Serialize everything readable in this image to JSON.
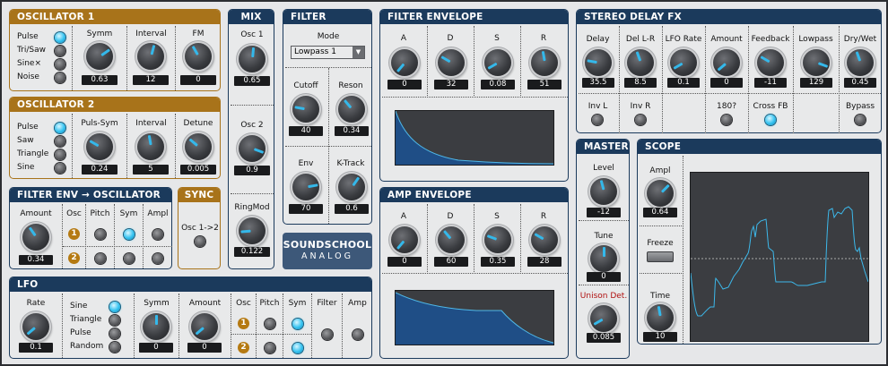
{
  "osc1": {
    "title": "OSCILLATOR 1",
    "waves": [
      "Pulse",
      "Tri/Saw",
      "Sine×",
      "Noise"
    ],
    "symm_label": "Symm",
    "interval_label": "Interval",
    "fm_label": "FM",
    "symm": "0.63",
    "interval": "12",
    "fm": "0"
  },
  "osc2": {
    "title": "OSCILLATOR 2",
    "waves": [
      "Pulse",
      "Saw",
      "Triangle",
      "Sine"
    ],
    "pulsesym_label": "Puls-Sym",
    "interval_label": "Interval",
    "detune_label": "Detune",
    "pulsesym": "0.24",
    "interval": "5",
    "detune": "0.005"
  },
  "fenvosc": {
    "title": "FILTER ENV → OSCILLATOR",
    "amount_label": "Amount",
    "amount": "0.34",
    "osc_label": "Osc",
    "pitch_label": "Pitch",
    "sym_label": "Sym",
    "ampl_label": "Ampl",
    "n1": "1",
    "n2": "2"
  },
  "sync": {
    "title": "SYNC",
    "label": "Osc 1->2"
  },
  "mix": {
    "title": "MIX",
    "osc1_label": "Osc 1",
    "osc2_label": "Osc 2",
    "ringmod_label": "RingMod",
    "osc1": "0.65",
    "osc2": "0.9",
    "ringmod": "0.122"
  },
  "filter": {
    "title": "FILTER",
    "mode_label": "Mode",
    "mode": "Lowpass 1",
    "cutoff_label": "Cutoff",
    "reson_label": "Reson",
    "env_label": "Env",
    "ktrack_label": "K-Track",
    "cutoff": "40",
    "reson": "0.34",
    "env": "70",
    "ktrack": "0.6"
  },
  "logo": {
    "line1": "SOUNDSCHOOL",
    "line2": "ANALOG"
  },
  "fenv": {
    "title": "FILTER ENVELOPE",
    "a_label": "A",
    "d_label": "D",
    "s_label": "S",
    "r_label": "R",
    "a": "0",
    "d": "32",
    "s": "0.08",
    "r": "51"
  },
  "aenv": {
    "title": "AMP ENVELOPE",
    "a_label": "A",
    "d_label": "D",
    "s_label": "S",
    "r_label": "R",
    "a": "0",
    "d": "60",
    "s": "0.35",
    "r": "28"
  },
  "delay": {
    "title": "STEREO DELAY FX",
    "delay_label": "Delay",
    "dellr_label": "Del L-R",
    "lforate_label": "LFO Rate",
    "amount_label": "Amount",
    "feedback_label": "Feedback",
    "lowpass_label": "Lowpass",
    "drywet_label": "Dry/Wet",
    "delay": "35.5",
    "dellr": "8.5",
    "lforate": "0.1",
    "amount": "0",
    "feedback": "-11",
    "lowpass": "129",
    "drywet": "0.45",
    "invl_label": "Inv L",
    "invr_label": "Inv R",
    "deg180_label": "180?",
    "crossfb_label": "Cross FB",
    "bypass_label": "Bypass"
  },
  "master": {
    "title": "MASTER",
    "level_label": "Level",
    "tune_label": "Tune",
    "unison_label": "Unison Det.",
    "level": "-12",
    "tune": "0",
    "unison": "0.085"
  },
  "scope": {
    "title": "SCOPE",
    "ampl_label": "Ampl",
    "freeze_label": "Freeze",
    "time_label": "Time",
    "ampl": "0.64",
    "time": "10"
  },
  "lfo": {
    "title": "LFO",
    "rate_label": "Rate",
    "rate": "0.1",
    "waves": [
      "Sine",
      "Triangle",
      "Pulse",
      "Random"
    ],
    "symm_label": "Symm",
    "symm": "0",
    "amount_label": "Amount",
    "amount": "0",
    "osc_label": "Osc",
    "pitch_label": "Pitch",
    "sym_label": "Sym",
    "filter_label": "Filter",
    "amp_label": "Amp",
    "n1": "1",
    "n2": "2"
  },
  "colors": {
    "panel_blue": "#1b3a5c",
    "panel_orange": "#a8731a",
    "led_on": "#33c2f0",
    "knob_indicator": "#34b8ea",
    "unison_label": "#b01010"
  }
}
